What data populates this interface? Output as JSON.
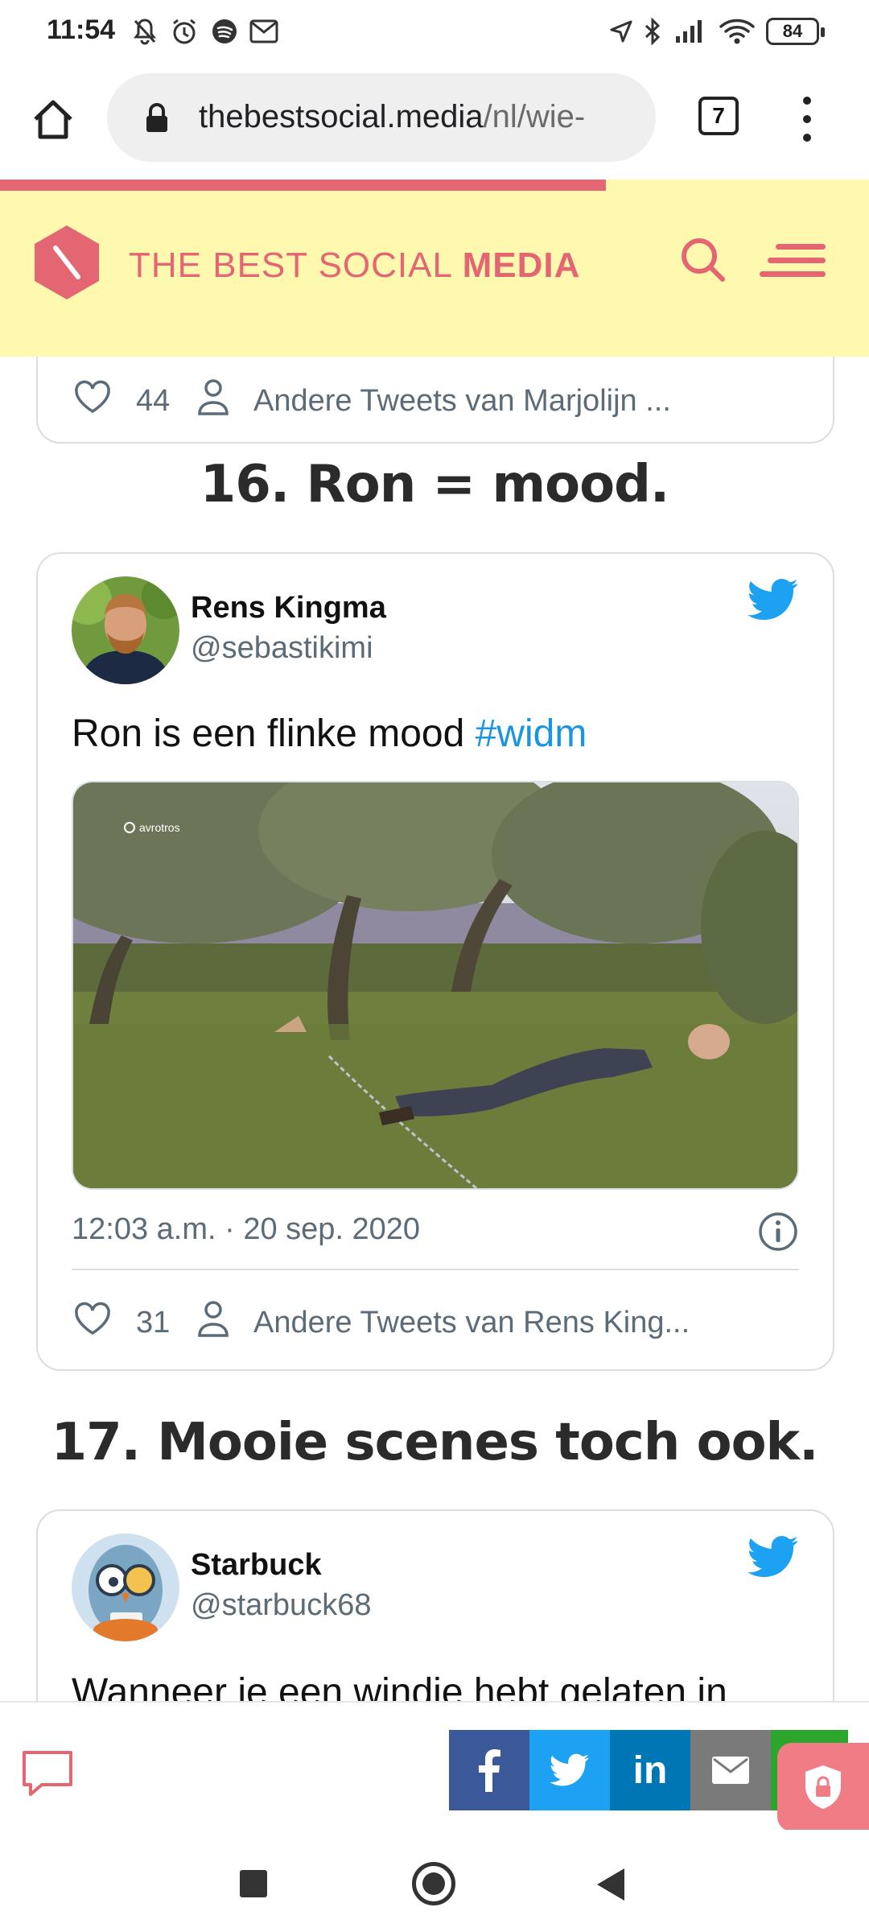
{
  "status_bar": {
    "time": "11:54",
    "battery": "84"
  },
  "browser": {
    "url_host": "thebestsocial.media",
    "url_path": "/nl/wie-",
    "tab_count": "7"
  },
  "site": {
    "logo_regular": "THE BEST SOCIAL ",
    "logo_bold": "MEDIA",
    "accent_color": "#e46673",
    "header_bg": "#fff9b0"
  },
  "prev_card": {
    "likes": "44",
    "other_tweets": "Andere Tweets van Marjolijn ..."
  },
  "section16": {
    "heading": "16. Ron = mood."
  },
  "tweet16": {
    "name": "Rens Kingma",
    "handle": "@sebastikimi",
    "text": "Ron is een flinke mood ",
    "hashtag": "#widm",
    "media_watermark": "avrotros",
    "timestamp": "12:03 a.m. · 20 sep. 2020",
    "likes": "31",
    "other_tweets": "Andere Tweets van Rens King..."
  },
  "section17": {
    "heading": "17. Mooie scenes toch ook."
  },
  "tweet17": {
    "name": "Starbuck",
    "handle": "@starbuck68",
    "text_partial": "Wanneer je een windje hebt gelaten in"
  },
  "share": {
    "linkedin_label": "in"
  },
  "icons": [
    "home-icon",
    "lock-icon",
    "tabs-icon",
    "menu-icon",
    "search-icon",
    "hamburger-icon",
    "heart-icon",
    "person-icon",
    "twitter-bird-icon",
    "info-icon",
    "comment-icon",
    "facebook-icon",
    "twitter-icon",
    "linkedin-icon",
    "mail-icon",
    "lock-fab-icon"
  ]
}
